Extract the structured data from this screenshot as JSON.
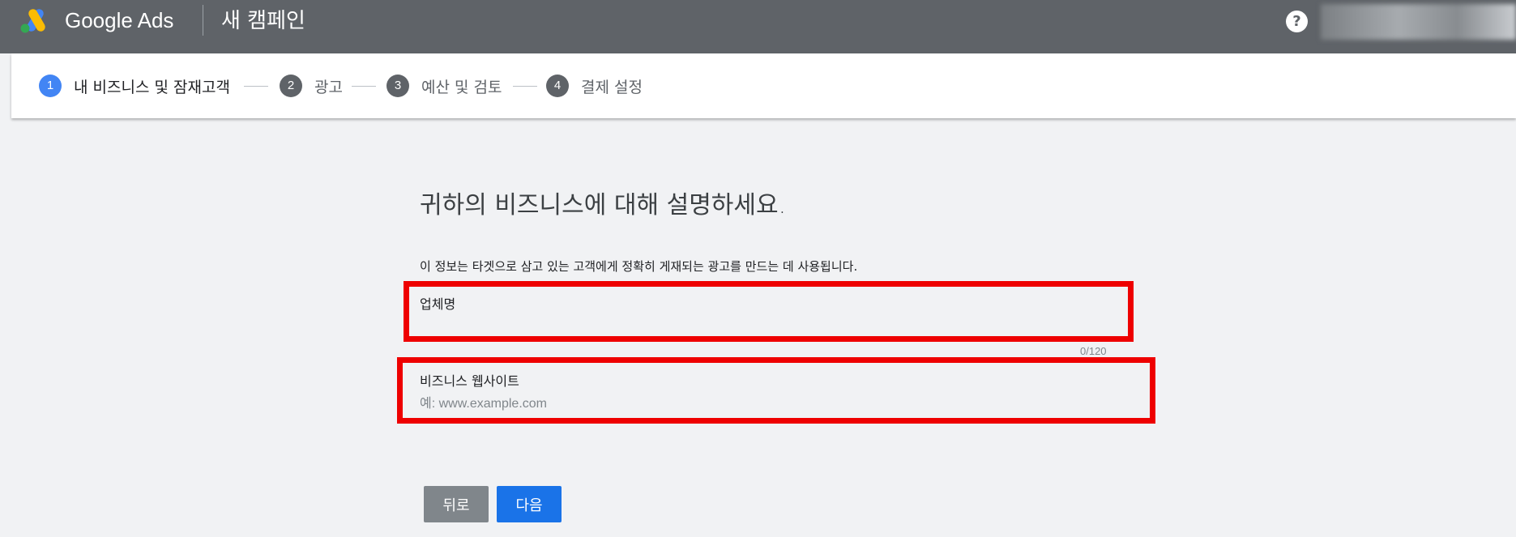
{
  "header": {
    "brand": "Google Ads",
    "campaign_title": "새 캠페인",
    "help_icon": "?"
  },
  "stepper": {
    "steps": [
      {
        "number": "1",
        "label": "내 비즈니스 및 잠재고객",
        "active": true
      },
      {
        "number": "2",
        "label": "광고",
        "active": false
      },
      {
        "number": "3",
        "label": "예산 및 검토",
        "active": false
      },
      {
        "number": "4",
        "label": "결제 설정",
        "active": false
      }
    ]
  },
  "form": {
    "heading": "귀하의 비즈니스에 대해 설명하세요.",
    "subtext": "이 정보는 타겟으로 삼고 있는 고객에게 정확히 게재되는 광고를 만드는 데 사용됩니다.",
    "business_name": {
      "label": "업체명",
      "value": "",
      "counter": "0/120"
    },
    "website": {
      "label": "비즈니스 웹사이트",
      "value": "",
      "placeholder": "예: www.example.com"
    }
  },
  "buttons": {
    "back": "뒤로",
    "next": "다음"
  },
  "colors": {
    "header_bg": "#5f6368",
    "active_step": "#4285f4",
    "primary_button": "#1a73e8",
    "secondary_button": "#80868b",
    "highlight": "#ee0000"
  }
}
